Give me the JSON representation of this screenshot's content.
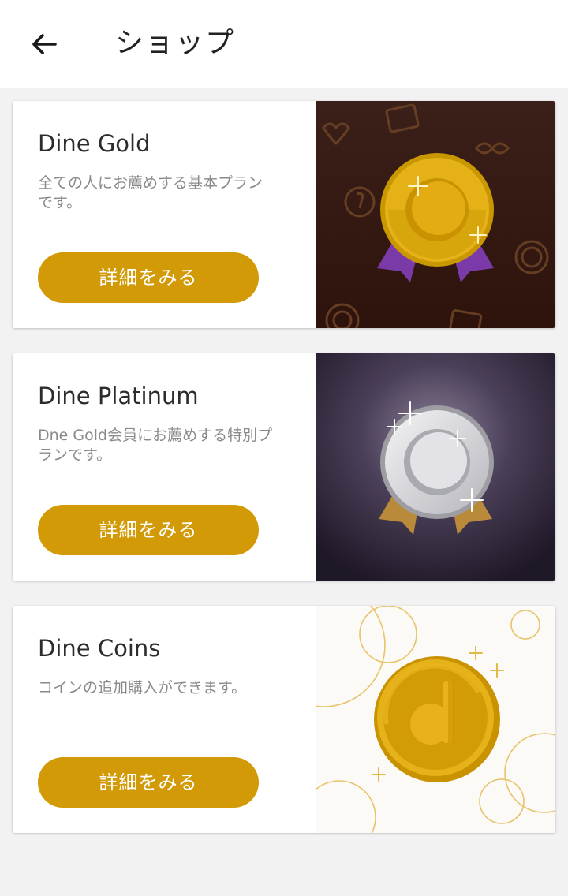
{
  "header": {
    "title": "ショップ",
    "back_icon": "arrow-left-icon"
  },
  "cards": [
    {
      "title": "Dine Gold",
      "description": "全ての人にお薦めする基本プランです。",
      "button_label": "詳細をみる",
      "image_icon": "gold-medal-icon"
    },
    {
      "title": "Dine Platinum",
      "description": "Dne Gold会員にお薦めする特別プランです。",
      "button_label": "詳細をみる",
      "image_icon": "platinum-medal-icon"
    },
    {
      "title": "Dine Coins",
      "description": "コインの追加購入ができます。",
      "button_label": "詳細をみる",
      "image_icon": "coin-icon"
    }
  ],
  "colors": {
    "accent": "#d29a06",
    "background": "#f2f2f2",
    "gold_art_background": "#3a1d15",
    "platinum_art_background": "#2a2233",
    "coins_art_background": "#fbfaf6"
  }
}
